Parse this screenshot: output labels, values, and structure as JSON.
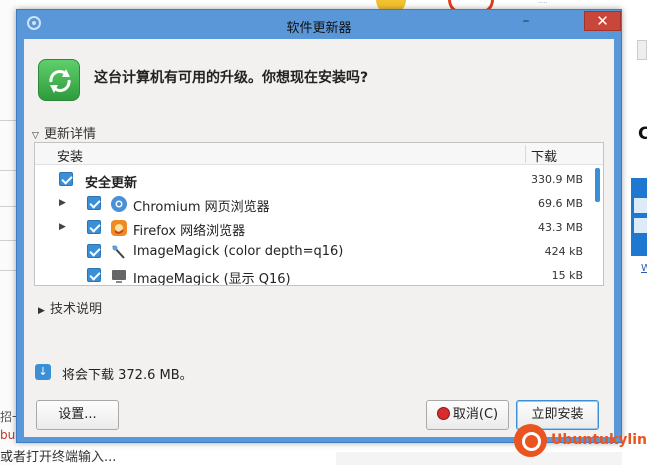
{
  "window": {
    "title": "软件更新器",
    "close_symbol": "✕",
    "minimize_symbol": "–"
  },
  "header": {
    "heading": "这台计算机有可用的升级。你想现在安装吗?",
    "icon": "refresh-icon"
  },
  "details": {
    "expander_label": "更新详情",
    "columns": {
      "install": "安装",
      "download": "下载"
    },
    "rows": [
      {
        "label": "安全更新",
        "size": "330.9 MB",
        "checked": true,
        "bold": true,
        "icon": "",
        "arrow": false
      },
      {
        "label": "Chromium 网页浏览器",
        "size": "69.6 MB",
        "checked": true,
        "bold": false,
        "icon": "chromium-icon",
        "arrow": true
      },
      {
        "label": "Firefox 网络浏览器",
        "size": "43.3 MB",
        "checked": true,
        "bold": false,
        "icon": "firefox-icon",
        "arrow": true
      },
      {
        "label": "ImageMagick (color depth=q16)",
        "size": "424 kB",
        "checked": true,
        "bold": false,
        "icon": "imagemagick-icon",
        "arrow": false
      },
      {
        "label": "ImageMagick (显示 Q16)",
        "size": "15 kB",
        "checked": true,
        "bold": false,
        "icon": "display-icon",
        "arrow": false
      }
    ]
  },
  "technical": {
    "expander_label": "技术说明"
  },
  "download_summary": "将会下载 372.6 MB。",
  "buttons": {
    "settings": "设置...",
    "cancel": "取消(C)",
    "install": "立即安装"
  },
  "background": {
    "bottom_text": "或者打开终端输入...",
    "red_fragment": "bu",
    "frag_1": "招一",
    "brand": "Ubuntukylin",
    "right_letter": "C",
    "right_link": "W"
  },
  "colors": {
    "window_border": "#5a97d8",
    "accent": "#3b8fd6",
    "close_button": "#c9473a",
    "brand": "#e95420"
  }
}
